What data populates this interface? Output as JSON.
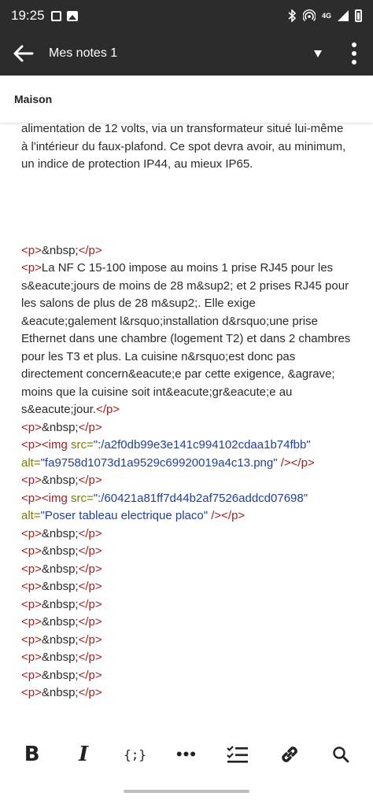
{
  "status_bar": {
    "time": "19:25",
    "left_icons": [
      "notification-square-icon",
      "image-icon"
    ],
    "right_icons": [
      "bluetooth-icon",
      "hotspot-icon",
      "network-4g-icon",
      "signal-icon",
      "battery-icon"
    ],
    "network_label": "4G"
  },
  "app_bar": {
    "title": "Mes notes 1",
    "back_icon": "arrow-left-icon",
    "dropdown_icon": "triangle-down-icon",
    "menu_icon": "more-vertical-icon"
  },
  "folder": {
    "name": "Maison"
  },
  "editor": {
    "paragraph": "alimentation de 12 volts, via un transformateur situé lui-même à l'intérieur du faux-plafond. Ce spot devra avoir, au minimum, un indice de protection IP44, au mieux IP65.",
    "lines": [
      {
        "tag_open": "<p>",
        "text": "&nbsp;",
        "tag_close": "</p>"
      },
      {
        "tag_open": "<p>",
        "text": "La NF C 15-100 impose au moins 1 prise RJ45 pour les s&eacute;jours de moins de 28 m&sup2; et 2 prises RJ45 pour les salons de plus de 28 m&sup2;. Elle exige &eacute;galement l&rsquo;installation d&rsquo;une prise Ethernet dans une chambre (logement T2) et dans 2 chambres pour les T3 et plus. La cuisine n&rsquo;est donc pas directement concern&eacute;e par cette exigence, &agrave; moins que la cuisine soit int&eacute;gr&eacute;e au s&eacute;jour.",
        "tag_close": "</p>"
      },
      {
        "tag_open": "<p>",
        "text": "&nbsp;",
        "tag_close": "</p>"
      }
    ],
    "img1": {
      "p_open": "<p>",
      "img_open": "<img",
      "src_attr": " src=",
      "src_value": "\":/a2f0db99e3e141c994102cdaa1b74fbb\"",
      "alt_attr": "alt=",
      "alt_value": "\"fa9758d1073d1a9529c69920019a4c13.png\"",
      "close": " /></p>"
    },
    "line_after_img1": {
      "tag_open": "<p>",
      "text": "&nbsp;",
      "tag_close": "</p>"
    },
    "img2": {
      "p_open": "<p>",
      "img_open": "<img",
      "src_attr": " src=",
      "src_value": "\":/60421a81ff7d44b2af7526addcd07698\"",
      "alt_attr": "alt=",
      "alt_value": "\"Poser tableau electrique placo\"",
      "close": " /></p>"
    },
    "trailing": [
      {
        "tag_open": "<p>",
        "text": "&nbsp;",
        "tag_close": "</p>"
      },
      {
        "tag_open": "<p>",
        "text": "&nbsp;",
        "tag_close": "</p>"
      },
      {
        "tag_open": "<p>",
        "text": "&nbsp;",
        "tag_close": "</p>"
      },
      {
        "tag_open": "<p>",
        "text": "&nbsp;",
        "tag_close": "</p>"
      },
      {
        "tag_open": "<p>",
        "text": "&nbsp;",
        "tag_close": "</p>"
      },
      {
        "tag_open": "<p>",
        "text": "&nbsp;",
        "tag_close": "</p>"
      },
      {
        "tag_open": "<p>",
        "text": "&nbsp;",
        "tag_close": "</p>"
      },
      {
        "tag_open": "<p>",
        "text": "&nbsp;",
        "tag_close": "</p>"
      },
      {
        "tag_open": "<p>",
        "text": "&nbsp;",
        "tag_close": "</p>"
      },
      {
        "tag_open": "<p>",
        "text": "&nbsp;",
        "tag_close": "</p>"
      }
    ]
  },
  "toolbar": {
    "bold_label": "B",
    "italic_label": "I",
    "code_label": "{;}",
    "more_label": "•••",
    "icons": [
      "bold-icon",
      "italic-icon",
      "code-icon",
      "more-horizontal-icon",
      "checklist-icon",
      "link-icon",
      "search-icon"
    ]
  }
}
